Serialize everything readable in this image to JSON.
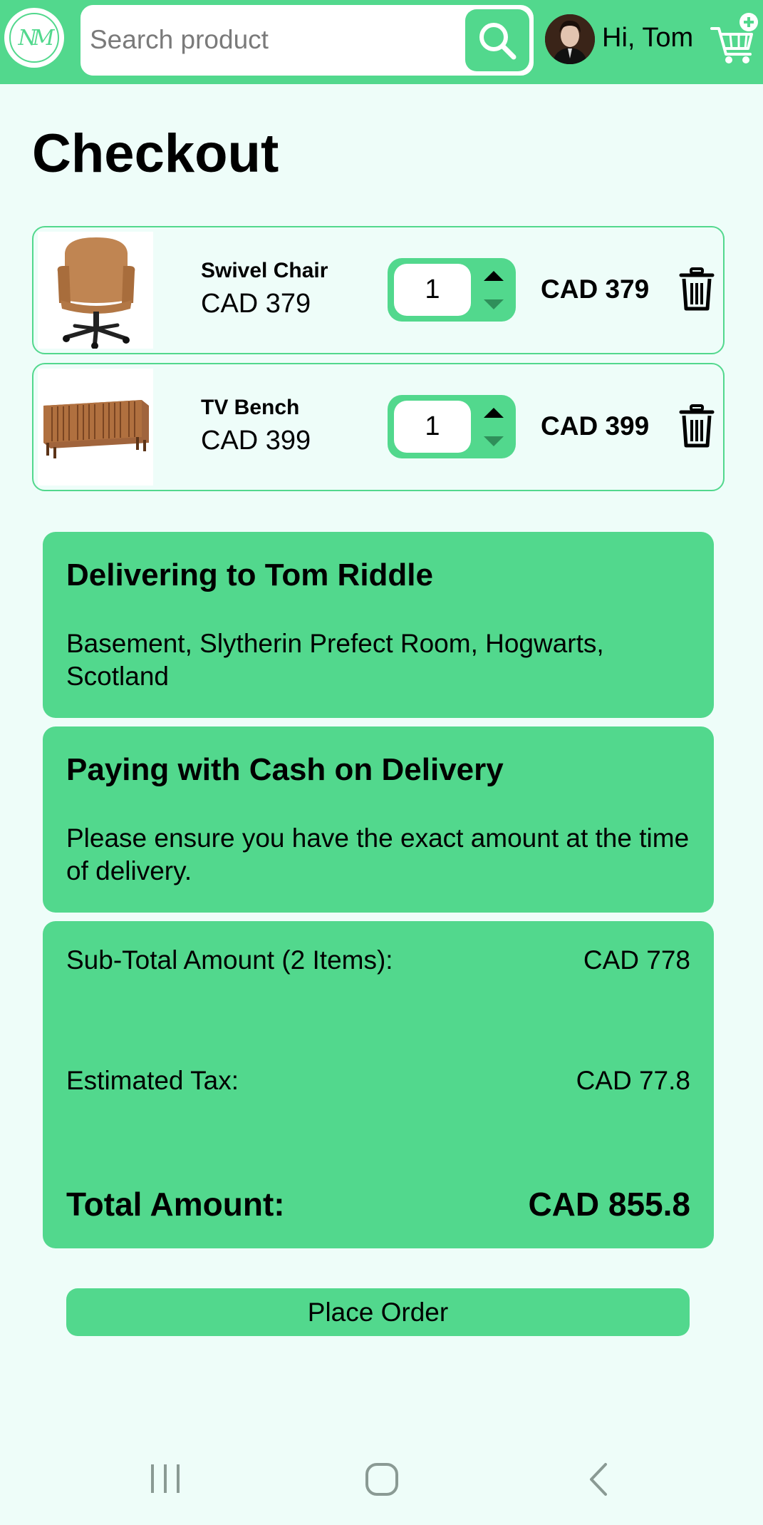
{
  "header": {
    "logo_text": "NM",
    "search_placeholder": "Search product",
    "greeting": "Hi, Tom"
  },
  "page_title": "Checkout",
  "cart_items": [
    {
      "name": "Swivel Chair",
      "unit_price": "CAD 379",
      "quantity": "1",
      "line_total": "CAD 379"
    },
    {
      "name": "TV Bench",
      "unit_price": "CAD 399",
      "quantity": "1",
      "line_total": "CAD 399"
    }
  ],
  "delivery": {
    "title": "Delivering to Tom Riddle",
    "address": "Basement, Slytherin Prefect Room, Hogwarts, Scotland"
  },
  "payment": {
    "title": "Paying with Cash on Delivery",
    "note": "Please ensure you have the exact amount at the time of delivery."
  },
  "summary": {
    "subtotal_label": "Sub-Total Amount (2 Items):",
    "subtotal_value": "CAD 778",
    "tax_label": "Estimated Tax:",
    "tax_value": "CAD 77.8",
    "total_label": "Total Amount:",
    "total_value": "CAD 855.8"
  },
  "place_order_label": "Place Order",
  "colors": {
    "accent": "#52d88d",
    "background": "#eefdf9"
  },
  "icons": [
    "search-icon",
    "cart-add-icon",
    "arrow-up-icon",
    "arrow-down-icon",
    "trash-icon",
    "recent-apps-icon",
    "home-icon",
    "back-icon"
  ]
}
